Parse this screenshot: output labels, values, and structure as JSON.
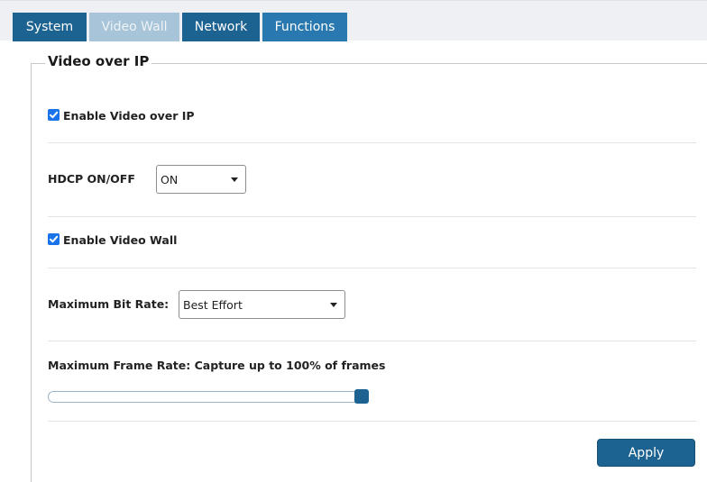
{
  "tabs": [
    {
      "label": "System"
    },
    {
      "label": "Video Wall"
    },
    {
      "label": "Network"
    },
    {
      "label": "Functions"
    }
  ],
  "section": {
    "legend": "Video over IP"
  },
  "enable_video_over_ip": {
    "label": "Enable Video over IP",
    "checked": true
  },
  "hdcp": {
    "label": "HDCP ON/OFF",
    "value": "ON"
  },
  "enable_video_wall": {
    "label": "Enable Video Wall",
    "checked": true
  },
  "max_bit_rate": {
    "label": "Maximum Bit Rate:",
    "value": "Best Effort"
  },
  "max_frame_rate": {
    "label": "Maximum Frame Rate: Capture up to 100% of frames",
    "slider_percent": 100
  },
  "apply": {
    "label": "Apply"
  },
  "colors": {
    "tab_active": "#1c6392",
    "tab_inactive": "#a8c4d8",
    "checkbox": "#1a73e8"
  }
}
